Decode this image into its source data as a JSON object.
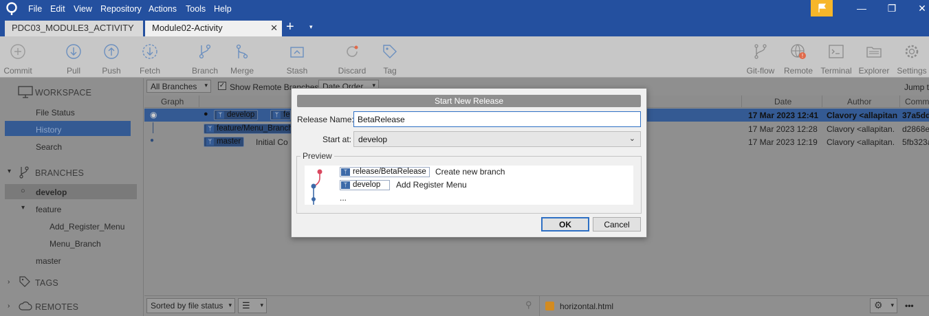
{
  "menu": [
    "File",
    "Edit",
    "View",
    "Repository",
    "Actions",
    "Tools",
    "Help"
  ],
  "tabs": [
    {
      "label": "PDC03_MODULE3_ACTIVITY"
    },
    {
      "label": "Module02-Activity",
      "close": "✕"
    }
  ],
  "tab_add": "+",
  "tab_menu": "▾",
  "window_controls": {
    "minimize": "—",
    "maximize": "❐",
    "close": "✕"
  },
  "toolbar": {
    "commit": "Commit",
    "pull": "Pull",
    "push": "Push",
    "fetch": "Fetch",
    "branch": "Branch",
    "merge": "Merge",
    "stash": "Stash",
    "discard": "Discard",
    "tag": "Tag",
    "gitflow": "Git-flow",
    "remote": "Remote",
    "terminal": "Terminal",
    "explorer": "Explorer",
    "settings": "Settings"
  },
  "sidebar": {
    "workspace": "WORKSPACE",
    "file_status": "File Status",
    "history": "History",
    "search": "Search",
    "branches": "BRANCHES",
    "develop": "develop",
    "feature": "feature",
    "add_register_menu": "Add_Register_Menu",
    "menu_branch": "Menu_Branch",
    "master": "master",
    "tags": "TAGS",
    "remotes": "REMOTES"
  },
  "filterbar": {
    "all_branches": "All Branches",
    "show_remote": "Show Remote Branches",
    "date_order": "Date Order",
    "jump_to": "Jump t"
  },
  "columns": {
    "graph": "Graph",
    "date": "Date",
    "author": "Author",
    "commit": "Comm"
  },
  "rows": [
    {
      "tag1": "develop",
      "tag2": "fe",
      "date": "17 Mar 2023 12:41",
      "author": "Clavory <allapitan",
      "hash": "37a5dd"
    },
    {
      "tag1": "feature/Menu_Branch",
      "date": "17 Mar 2023 12:28",
      "author": "Clavory <allapitan.",
      "hash": "d2868e"
    },
    {
      "tag1": "master",
      "desc": "Initial Co",
      "date": "17 Mar 2023 12:19",
      "author": "Clavory <allapitan.",
      "hash": "5fb323a"
    }
  ],
  "bottombar": {
    "sorted": "Sorted by file status",
    "file": "horizontal.html",
    "more": "•••"
  },
  "dialog": {
    "title": "Start New Release",
    "release_name_label": "Release Name:",
    "release_name_value": "BetaRelease",
    "start_at_label": "Start at:",
    "start_at_value": "develop",
    "preview_label": "Preview",
    "preview": [
      {
        "branch": "release/BetaRelease",
        "message": "Create new branch"
      },
      {
        "branch": "develop",
        "message": "Add Register Menu"
      }
    ],
    "ellipsis": "...",
    "ok": "OK",
    "cancel": "Cancel"
  },
  "colors": {
    "titlebar": "#24509f",
    "selection": "#345a93",
    "flag": "#f6b62a",
    "preview_release_dot": "#d9485f",
    "preview_develop_dot": "#3d6aa8"
  }
}
